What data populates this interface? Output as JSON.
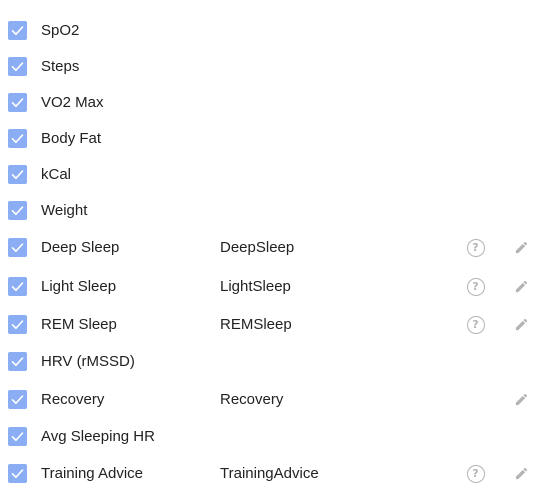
{
  "colors": {
    "checkbox_fill": "#8aadf4",
    "icon_gray": "#b4b4b4",
    "text": "#222222"
  },
  "help_glyph": "?",
  "rows": [
    {
      "label": "SpO2",
      "checked": true,
      "key": "",
      "help": false,
      "edit": false
    },
    {
      "label": "Steps",
      "checked": true,
      "key": "",
      "help": false,
      "edit": false
    },
    {
      "label": "VO2 Max",
      "checked": true,
      "key": "",
      "help": false,
      "edit": false
    },
    {
      "label": "Body Fat",
      "checked": true,
      "key": "",
      "help": false,
      "edit": false
    },
    {
      "label": "kCal",
      "checked": true,
      "key": "",
      "help": false,
      "edit": false
    },
    {
      "label": "Weight",
      "checked": true,
      "key": "",
      "help": false,
      "edit": false
    },
    {
      "label": "Deep Sleep",
      "checked": true,
      "key": "DeepSleep",
      "help": true,
      "edit": true
    },
    {
      "label": "Light Sleep",
      "checked": true,
      "key": "LightSleep",
      "help": true,
      "edit": true
    },
    {
      "label": "REM Sleep",
      "checked": true,
      "key": "REMSleep",
      "help": true,
      "edit": true
    },
    {
      "label": "HRV (rMSSD)",
      "checked": true,
      "key": "",
      "help": false,
      "edit": false
    },
    {
      "label": "Recovery",
      "checked": true,
      "key": "Recovery",
      "help": false,
      "edit": true
    },
    {
      "label": "Avg Sleeping HR",
      "checked": true,
      "key": "",
      "help": false,
      "edit": false
    },
    {
      "label": "Training Advice",
      "checked": true,
      "key": "TrainingAdvice",
      "help": true,
      "edit": true
    }
  ]
}
